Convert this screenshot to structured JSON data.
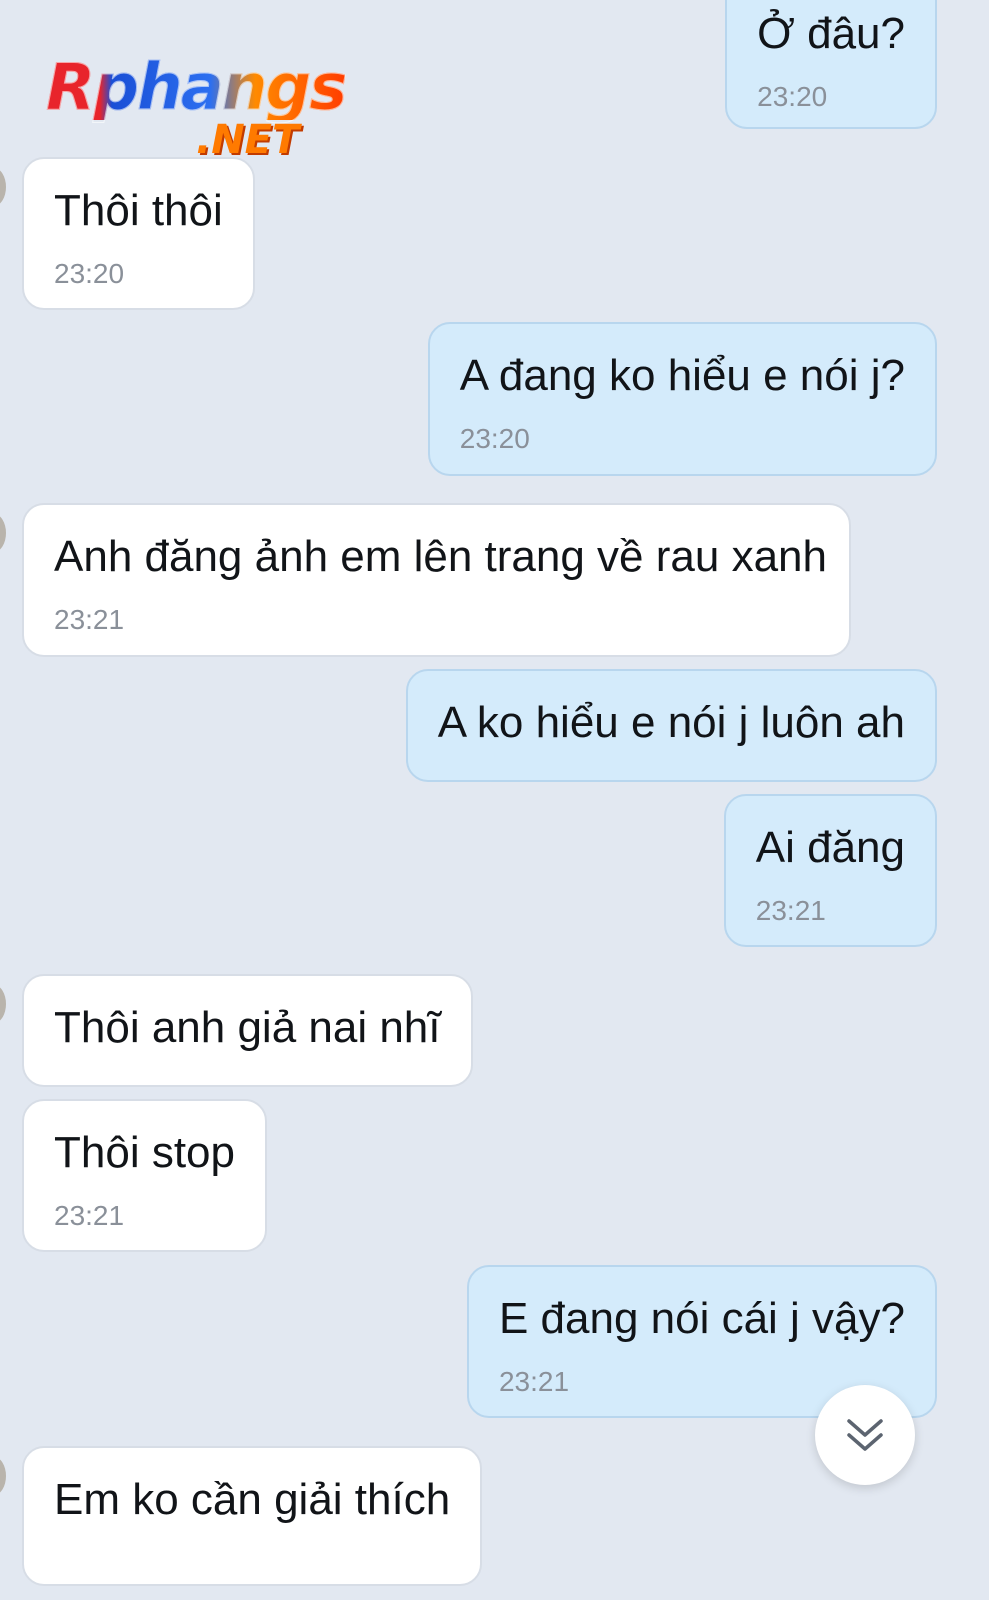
{
  "brand": {
    "logo_main": "Rphangs",
    "logo_sub": ".NET"
  },
  "messages": [
    {
      "direction": "outgoing",
      "text": "Ở đâu?",
      "time": "23:20"
    },
    {
      "direction": "incoming",
      "text": "Thôi thôi",
      "time": "23:20"
    },
    {
      "direction": "outgoing",
      "text": "A đang ko hiểu e nói j?",
      "time": "23:20"
    },
    {
      "direction": "incoming",
      "text": "Anh đăng ảnh em lên trang về rau xanh",
      "time": "23:21"
    },
    {
      "direction": "outgoing",
      "text": "A ko hiểu e nói j luôn ah",
      "time": ""
    },
    {
      "direction": "outgoing",
      "text": "Ai đăng",
      "time": "23:21"
    },
    {
      "direction": "incoming",
      "text": "Thôi anh giả nai nhĩ",
      "time": ""
    },
    {
      "direction": "incoming",
      "text": "Thôi stop",
      "time": "23:21"
    },
    {
      "direction": "outgoing",
      "text": "E đang nói cái j vậy?",
      "time": "23:21"
    },
    {
      "direction": "incoming",
      "text": "Em ko cần giải thích",
      "time": ""
    }
  ],
  "controls": {
    "scroll_down_icon": "double-chevron-down-icon"
  },
  "colors": {
    "background": "#e2e8f1",
    "incoming_bubble": "#ffffff",
    "outgoing_bubble": "#d4ebfb",
    "timestamp": "#8a9099"
  }
}
